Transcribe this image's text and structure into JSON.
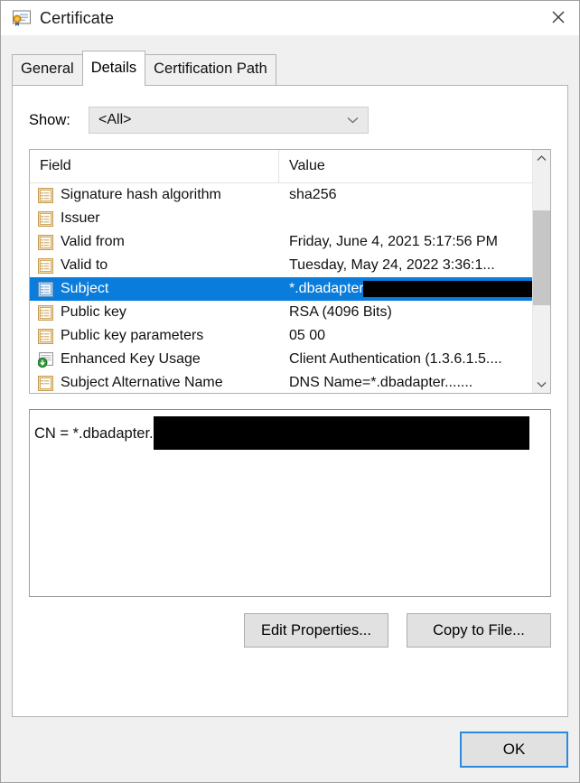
{
  "window": {
    "title": "Certificate",
    "icon": "certificate-icon",
    "close_label": "✕"
  },
  "tabs": [
    {
      "label": "General",
      "selected": false
    },
    {
      "label": "Details",
      "selected": true
    },
    {
      "label": "Certification Path",
      "selected": false
    }
  ],
  "show": {
    "label": "Show:",
    "value": "<All>",
    "arrow_icon": "chevron-down-icon"
  },
  "field_list": {
    "columns": {
      "field": "Field",
      "value": "Value"
    },
    "rows": [
      {
        "icon": "certificate-field-icon",
        "field": "Signature hash algorithm",
        "value": "sha256",
        "selected": false,
        "redacted": false
      },
      {
        "icon": "certificate-field-icon",
        "field": "Issuer",
        "value": "",
        "selected": false,
        "redacted": true
      },
      {
        "icon": "certificate-field-icon",
        "field": "Valid from",
        "value": "Friday, June 4, 2021 5:17:56 PM",
        "selected": false,
        "redacted": false
      },
      {
        "icon": "certificate-field-icon",
        "field": "Valid to",
        "value": "Tuesday, May 24, 2022 3:36:1...",
        "selected": false,
        "redacted": false
      },
      {
        "icon": "certificate-field-icon",
        "field": "Subject",
        "value": "*.dbadapter.",
        "selected": true,
        "redacted": true
      },
      {
        "icon": "certificate-field-icon",
        "field": "Public key",
        "value": "RSA (4096 Bits)",
        "selected": false,
        "redacted": false
      },
      {
        "icon": "certificate-field-icon",
        "field": "Public key parameters",
        "value": "05 00",
        "selected": false,
        "redacted": false
      },
      {
        "icon": "certificate-extension-icon",
        "field": "Enhanced Key Usage",
        "value": "Client Authentication (1.3.6.1.5....",
        "selected": false,
        "redacted": false
      },
      {
        "icon": "certificate-field-icon",
        "field": "Subject Alternative Name",
        "value": "DNS Name=*.dbadapter.......",
        "selected": false,
        "redacted": false
      }
    ],
    "scrollbar": {
      "up_icon": "scroll-up-arrow-icon",
      "down_icon": "scroll-down-arrow-icon"
    }
  },
  "detail": {
    "text": "CN = *.dbadapter.",
    "redacted": true
  },
  "actions": {
    "edit_properties": "Edit Properties...",
    "copy_to_file": "Copy to File..."
  },
  "footer": {
    "ok": "OK"
  },
  "colors": {
    "selection_blue": "#0a7cdb",
    "focus_blue": "#2a8bdc",
    "dialog_bg": "#f0f0f0",
    "redaction": "#000000"
  }
}
